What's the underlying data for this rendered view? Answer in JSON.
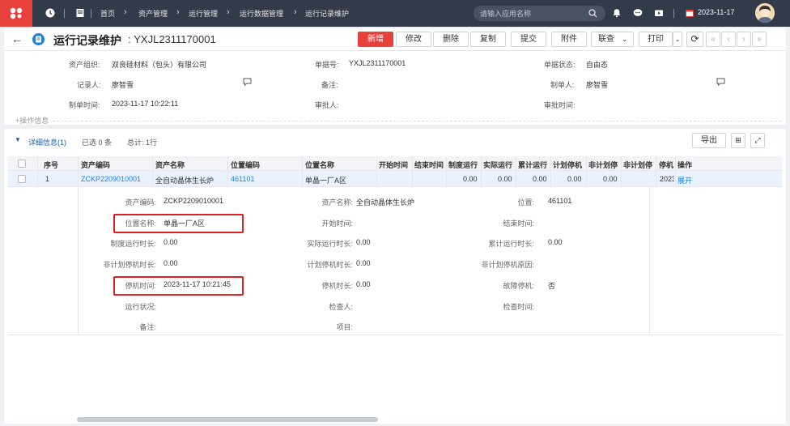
{
  "topbar": {
    "breadcrumbs": [
      "首页",
      "资产管理",
      "运行管理",
      "运行数据管理",
      "运行记录维护"
    ],
    "search_placeholder": "请输入应用名称",
    "date": "2023-11-17"
  },
  "titlebar": {
    "title": "运行记录维护",
    "separator": ":",
    "code": "YXJL2311170001",
    "buttons": {
      "add": "新增",
      "edit": "修改",
      "delete": "删除",
      "copy": "复制",
      "submit": "提交",
      "attach": "附件",
      "link": "联查",
      "print": "打印"
    }
  },
  "header_fields": {
    "asset_org_label": "资产组织:",
    "asset_org_value": "双良硅材料（包头）有限公司",
    "bill_no_label": "单据号:",
    "bill_no_value": "YXJL2311170001",
    "bill_status_label": "单据状态:",
    "bill_status_value": "自由态",
    "recorder_label": "记录人:",
    "recorder_value": "廖智雪",
    "remark_label": "备注:",
    "maker_label": "制单人:",
    "maker_value": "廖智雪",
    "make_time_label": "制单时间:",
    "make_time_value": "2023-11-17 10:22:11",
    "approver_label": "审批人:",
    "approve_time_label": "审批时间:",
    "op_info": "+操作信息"
  },
  "section": {
    "title": "详细信息(1)",
    "selected": "已选 0 条",
    "total": "总计: 1行",
    "export_label": "导出"
  },
  "grid": {
    "columns": [
      "序号",
      "资产编码",
      "资产名称",
      "位置编码",
      "位置名称",
      "开始时间",
      "结束时间",
      "制度运行",
      "实际运行",
      "累计运行",
      "计划停机",
      "非计划停",
      "非计划停",
      "停机",
      "操作"
    ],
    "row": {
      "index": "1",
      "asset_code": "ZCKP2209010001",
      "asset_name": "全自动晶体生长炉",
      "location_code": "461101",
      "location_name": "单晶一厂A区",
      "sys_run": "0.00",
      "actual_run": "0.00",
      "cum_run": "0.00",
      "plan_stop": "0.00",
      "unplan_stop": "0.00",
      "stop_time": "2023",
      "action": "展开"
    }
  },
  "detail": {
    "asset_code_label": "资产编码:",
    "asset_code_value": "ZCKP2209010001",
    "asset_name_label": "资产名称:",
    "asset_name_value": "全自动晶体生长炉",
    "position_label": "位置:",
    "position_value": "461101",
    "location_name_label": "位置名称:",
    "location_name_value": "单晶一厂A区",
    "start_time_label": "开始时间:",
    "end_time_label": "结束时间:",
    "sys_run_label": "制度运行时长:",
    "sys_run_value": "0.00",
    "actual_run_label": "实际运行时长:",
    "actual_run_value": "0.00",
    "cum_run_label": "累计运行时长:",
    "cum_run_value": "0.00",
    "unplan_stop_label": "非计划停机时长:",
    "unplan_stop_value": "0.00",
    "plan_stop_label": "计划停机时长:",
    "plan_stop_value": "0.00",
    "unplan_reason_label": "非计划停机原因:",
    "stop_time_label": "停机时间:",
    "stop_time_value": "2023-11-17 10:21:45",
    "stop_duration_label": "停机时长:",
    "stop_duration_value": "0.00",
    "fault_stop_label": "故障停机:",
    "fault_stop_value": "否",
    "run_status_label": "运行状况:",
    "inspector_label": "检查人:",
    "inspect_time_label": "检查时间:",
    "remark_label": "备注:",
    "project_label": "项目:"
  },
  "colors": {
    "brand": "#e8413c",
    "topbar": "#333a4a",
    "link": "#1e7fe6",
    "highlight": "#e02020"
  }
}
